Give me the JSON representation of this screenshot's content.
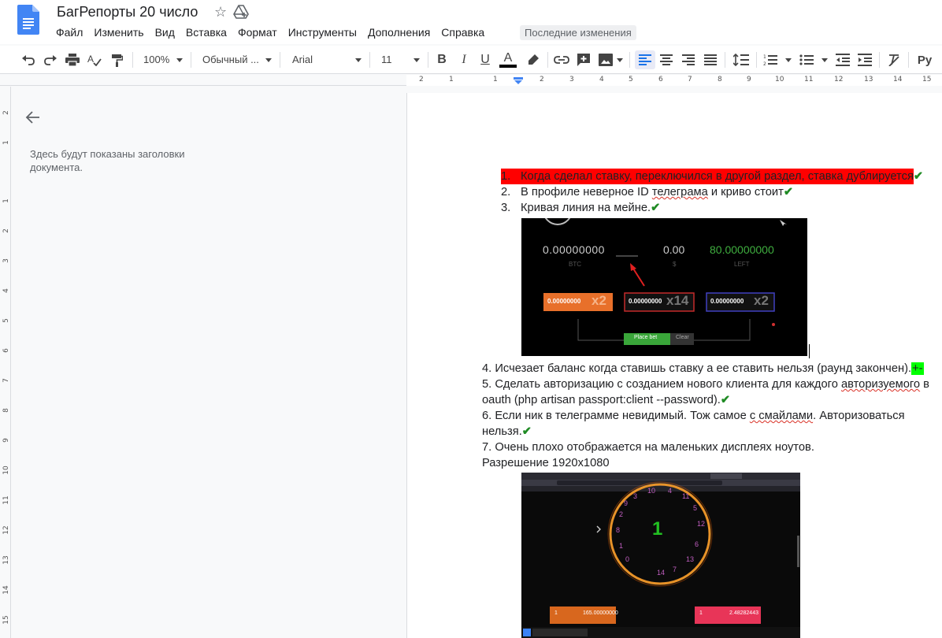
{
  "app": {
    "title": "БагРепорты 20 число",
    "menu": [
      "Файл",
      "Изменить",
      "Вид",
      "Вставка",
      "Формат",
      "Инструменты",
      "Дополнения",
      "Справка"
    ],
    "last_edit": "Последние изменения"
  },
  "toolbar": {
    "zoom": "100%",
    "style": "Обычный ...",
    "font": "Arial",
    "size": "11",
    "bold": "B",
    "italic": "I",
    "underline": "U",
    "text_color": "A",
    "input_tools": "Ру"
  },
  "ruler": {
    "labels": [
      "2",
      "1",
      "1",
      "2",
      "3",
      "4",
      "5",
      "6",
      "7",
      "8",
      "9",
      "10",
      "11",
      "12",
      "13",
      "14",
      "15"
    ],
    "vertical_labels": [
      "2",
      "1",
      "1",
      "2",
      "3",
      "4",
      "5",
      "6",
      "7",
      "8",
      "9",
      "10",
      "11",
      "12",
      "13",
      "14",
      "15"
    ]
  },
  "outline": {
    "text": "Здесь будут показаны заголовки документа."
  },
  "document": {
    "list_items": [
      {
        "num": "1.",
        "text": "Когда сделал ставку, переключился в другой раздел, ставка дублируется",
        "mark": "✔"
      },
      {
        "num": "2.",
        "text_before": "В профиле неверное ID ",
        "underlined": "телеграма",
        "text_after": " и криво стоит",
        "mark": "✔"
      },
      {
        "num": "3.",
        "text": "Кривая линия на мейне.",
        "mark": "✔"
      }
    ],
    "para4": "4. Исчезает баланс когда ставишь ставку а ее ставить нельзя (раунд закончен).",
    "para4_mark": "+-",
    "para5_line1_before": "5. Сделать авторизацию с созданием нового клиента для каждого ",
    "para5_line1_underlined": "авторизуемого",
    "para5_line1_after": " в",
    "para5_line2": "oauth (php artisan passport:client --password).",
    "para6_line1_before": "6. Если ник в телеграмме невидимый. Тож самое ",
    "para6_line1_underlined": "с смайлами",
    "para6_line1_after": ". Авторизоваться",
    "para6_line2": "нельзя.",
    "para7_line1": "7. Очень плохо отображается на маленьких дисплеях ноутов.",
    "para7_line2": "Разрешение 1920x1080",
    "check_mark": "✔"
  },
  "screenshot1": {
    "btc_value": "0.00000000",
    "btc_label": "BTC",
    "usd_value": "0.00",
    "usd_label": "$",
    "left_value": "80.00000000",
    "left_label": "LEFT",
    "bet1_value": "0.00000000",
    "bet1_mult": "x2",
    "bet2_value": "0.00000000",
    "bet2_mult": "x14",
    "bet3_value": "0.00000000",
    "bet3_mult": "x2",
    "place_bet": "Place bet",
    "clear": "Clear"
  },
  "screenshot2": {
    "center_number": "1",
    "wheel_numbers": [
      "3",
      "10",
      "4",
      "11",
      "5",
      "12",
      "6",
      "13",
      "7",
      "14",
      "0",
      "1",
      "8",
      "2",
      "9"
    ],
    "left_bet": "165.00000000",
    "right_bet": "2.48282443",
    "left_count": "1",
    "right_count": "1"
  },
  "colors": {
    "highlight_red": "#ff0000",
    "check_green": "#1f8b24",
    "highlight_green": "#00ff00",
    "bet_orange": "#e8702a",
    "place_bet_green": "#3aa63a"
  }
}
